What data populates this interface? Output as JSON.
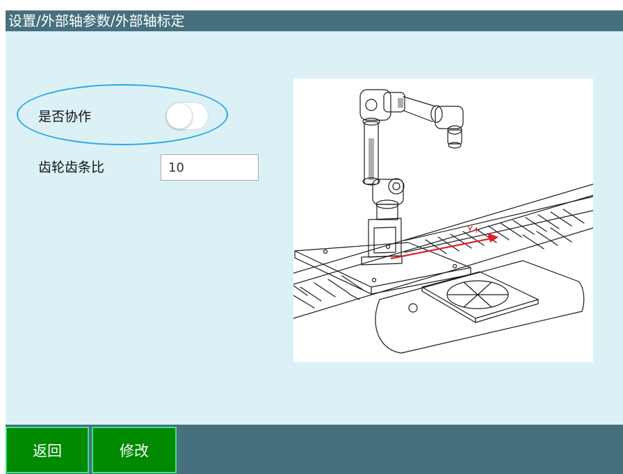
{
  "header": {
    "breadcrumb": "设置/外部轴参数/外部轴标定"
  },
  "form": {
    "cooperation": {
      "label": "是否协作",
      "enabled": false
    },
    "gear_ratio": {
      "label": "齿轮齿条比",
      "value": "10"
    }
  },
  "illustration": {
    "axis_label": "Y+",
    "arrow_color": "#e0202a"
  },
  "footer": {
    "back_label": "返回",
    "edit_label": "修改"
  },
  "colors": {
    "title_bar": "#46707e",
    "content_bg": "#dcf1f6",
    "button": "#008a00",
    "button_border": "#3fe08a",
    "highlight": "#2aa6e8"
  }
}
